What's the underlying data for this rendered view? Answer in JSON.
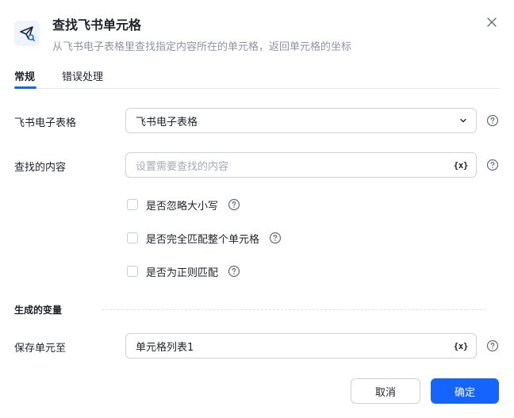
{
  "dialog": {
    "title": "查找飞书单元格",
    "subtitle": "从飞书电子表格里查找指定内容所在的单元格，返回单元格的坐标",
    "icon": "send-search-icon",
    "close_icon": "close-icon"
  },
  "tabs": [
    {
      "label": "常规",
      "active": true
    },
    {
      "label": "错误处理",
      "active": false
    }
  ],
  "form": {
    "sheet": {
      "label": "飞书电子表格",
      "value": "飞书电子表格"
    },
    "content": {
      "label": "查找的内容",
      "placeholder": "设置需要查找的内容",
      "badge": "{x}"
    },
    "options": [
      {
        "label": "是否忽略大小写",
        "checked": false
      },
      {
        "label": "是否完全匹配整个单元格",
        "checked": false
      },
      {
        "label": "是否为正则匹配",
        "checked": false
      }
    ]
  },
  "output": {
    "section_title": "生成的变量",
    "save": {
      "label": "保存单元至",
      "value": "单元格列表1",
      "badge": "{x}"
    }
  },
  "buttons": {
    "cancel": "取消",
    "ok": "确定"
  },
  "colors": {
    "primary": "#1664ff",
    "text": "#1f2329",
    "muted": "#8f959e",
    "border": "#d0d3d6"
  }
}
